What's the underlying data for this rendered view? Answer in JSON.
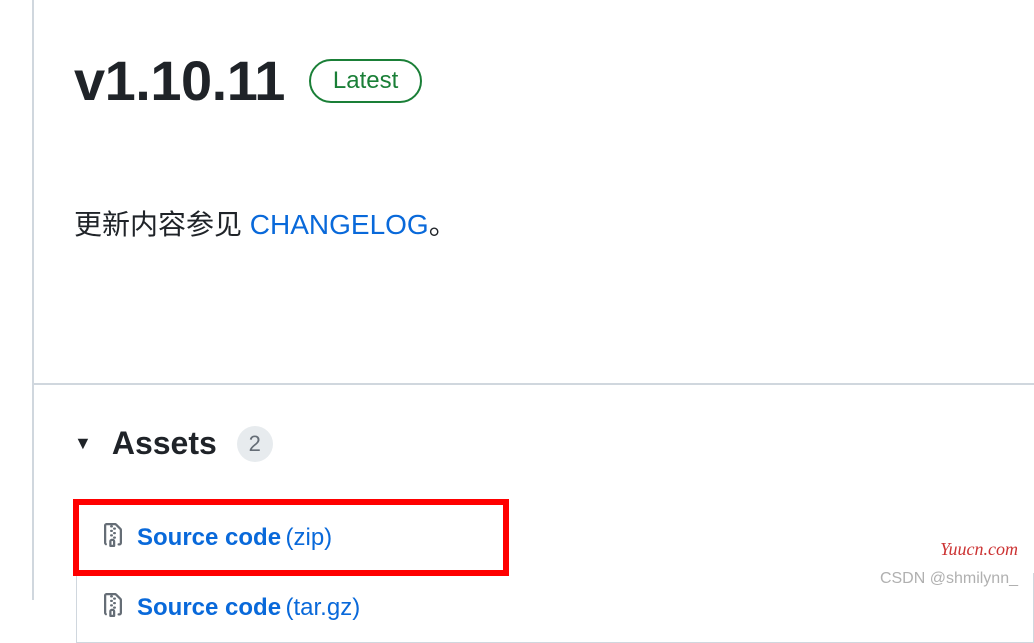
{
  "release": {
    "version": "v1.10.11",
    "badge": "Latest",
    "body_prefix": "更新内容参见 ",
    "body_link": "CHANGELOG",
    "body_suffix": "。"
  },
  "assets": {
    "title": "Assets",
    "count": "2",
    "items": [
      {
        "name": "Source code",
        "ext": "(zip)"
      },
      {
        "name": "Source code",
        "ext": "(tar.gz)"
      }
    ]
  },
  "watermarks": {
    "site": "Yuucn.com",
    "author": "CSDN @shmilynn_"
  }
}
